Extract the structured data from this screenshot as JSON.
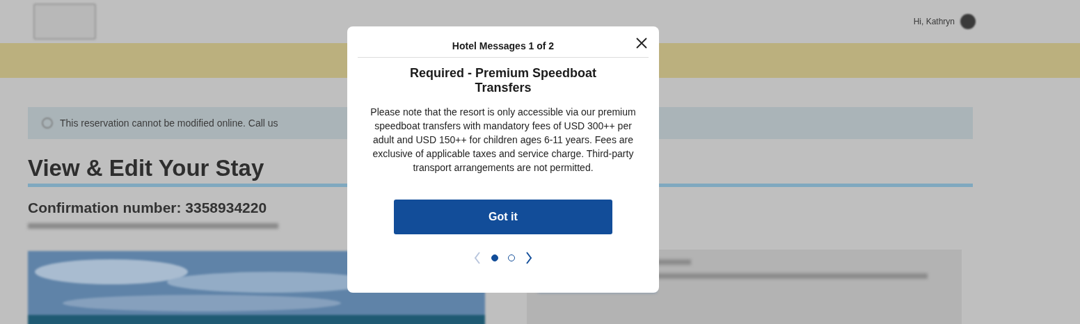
{
  "header": {
    "greeting": "Hi, Kathryn"
  },
  "alert": {
    "text": "This reservation cannot be modified online. Call us"
  },
  "page": {
    "title": "View & Edit Your Stay",
    "confirmation": "Confirmation number: 3358934220"
  },
  "modal": {
    "title": "Hotel Messages 1 of 2",
    "heading": "Required - Premium Speedboat Transfers",
    "body": "Please note that the resort is only accessible via our premium speedboat transfers with mandatory fees of USD 300++ per adult and USD 150++ for children ages 6-11 years. Fees are exclusive of applicable taxes and service charge. Third-party transport arrangements are not permitted.",
    "button": "Got it",
    "pager": {
      "prev_disabled": true,
      "next_disabled": false,
      "dots": [
        {
          "selected": true
        },
        {
          "selected": false
        }
      ]
    }
  }
}
